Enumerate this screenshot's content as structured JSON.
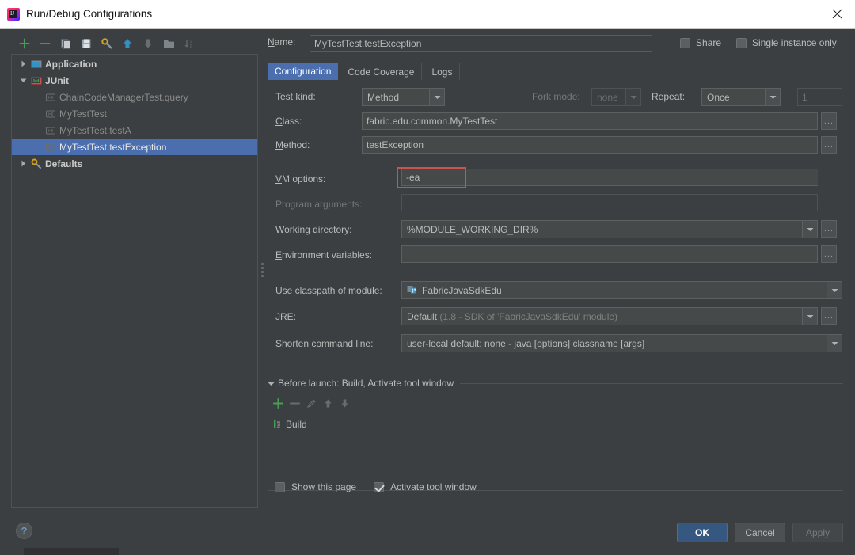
{
  "window": {
    "title": "Run/Debug Configurations",
    "app_icon": "intellij-idea-icon",
    "close_icon": "close-icon"
  },
  "toolbar": {
    "buttons": [
      {
        "name": "add-configuration-button",
        "icon": "plus-icon",
        "enabled": true
      },
      {
        "name": "remove-configuration-button",
        "icon": "minus-icon",
        "enabled": true
      },
      {
        "name": "copy-configuration-button",
        "icon": "copy-icon",
        "enabled": true
      },
      {
        "name": "save-configuration-button",
        "icon": "save-icon",
        "enabled": true
      },
      {
        "name": "edit-defaults-button",
        "icon": "wrench-icon",
        "enabled": true
      },
      {
        "name": "move-up-button",
        "icon": "arrow-up-icon",
        "enabled": true
      },
      {
        "name": "move-down-button",
        "icon": "arrow-down-icon",
        "enabled": false
      },
      {
        "name": "create-folder-button",
        "icon": "folder-icon",
        "enabled": false
      },
      {
        "name": "sort-configurations-button",
        "icon": "sort-icon",
        "enabled": false
      }
    ]
  },
  "tree": {
    "items": [
      {
        "label": "Application",
        "level": 0,
        "expanded": false,
        "bold": true,
        "icon": "application-icon",
        "selected": false,
        "dim": false
      },
      {
        "label": "JUnit",
        "level": 0,
        "expanded": true,
        "bold": true,
        "icon": "junit-icon",
        "selected": false,
        "dim": false
      },
      {
        "label": "ChainCodeManagerTest.query",
        "level": 1,
        "expanded": null,
        "bold": false,
        "icon": "junit-test-icon",
        "selected": false,
        "dim": true
      },
      {
        "label": "MyTestTest",
        "level": 1,
        "expanded": null,
        "bold": false,
        "icon": "junit-test-icon",
        "selected": false,
        "dim": true
      },
      {
        "label": "MyTestTest.testA",
        "level": 1,
        "expanded": null,
        "bold": false,
        "icon": "junit-test-icon",
        "selected": false,
        "dim": true
      },
      {
        "label": "MyTestTest.testException",
        "level": 1,
        "expanded": null,
        "bold": false,
        "icon": "junit-test-icon",
        "selected": true,
        "dim": false
      },
      {
        "label": "Defaults",
        "level": 0,
        "expanded": false,
        "bold": true,
        "icon": "defaults-icon",
        "selected": false,
        "dim": false
      }
    ]
  },
  "form": {
    "name_label": "Name:",
    "name_value": "MyTestTest.testException",
    "share_label": "Share",
    "share_checked": false,
    "single_instance_label": "Single instance only",
    "single_instance_checked": false,
    "tabs": [
      {
        "label": "Configuration",
        "active": true
      },
      {
        "label": "Code Coverage",
        "active": false
      },
      {
        "label": "Logs",
        "active": false
      }
    ],
    "test_kind_label": "Test kind:",
    "test_kind_value": "Method",
    "fork_mode_label": "Fork mode:",
    "fork_mode_value": "none",
    "fork_mode_enabled": false,
    "repeat_label": "Repeat:",
    "repeat_value": "Once",
    "repeat_count_value": "1",
    "repeat_count_enabled": false,
    "class_label": "Class:",
    "class_value": "fabric.edu.common.MyTestTest",
    "method_label": "Method:",
    "method_value": "testException",
    "vm_options_label": "VM options:",
    "vm_options_value": "-ea",
    "vm_options_highlighted": true,
    "program_arguments_label": "Program arguments:",
    "program_arguments_value": "",
    "working_directory_label": "Working directory:",
    "working_directory_value": "%MODULE_WORKING_DIR%",
    "environment_variables_label": "Environment variables:",
    "environment_variables_value": "",
    "use_classpath_label": "Use classpath of module:",
    "use_classpath_value": "FabricJavaSdkEdu",
    "use_classpath_icon": "module-icon",
    "jre_label": "JRE:",
    "jre_value_main": "Default",
    "jre_value_hint": "(1.8 - SDK of 'FabricJavaSdkEdu' module)",
    "shorten_command_line_label": "Shorten command line:",
    "shorten_command_line_value": "user-local default: none - java [options] classname [args]",
    "browse_label": "...",
    "expand_icon": "expand-arrows-icon",
    "dropdown_icon": "chevron-down-icon"
  },
  "before_launch": {
    "title": "Before launch: Build, Activate tool window",
    "toolbar": [
      {
        "name": "add-task-button",
        "icon": "plus-icon",
        "enabled": true
      },
      {
        "name": "remove-task-button",
        "icon": "minus-icon",
        "enabled": false
      },
      {
        "name": "edit-task-button",
        "icon": "pencil-icon",
        "enabled": false
      },
      {
        "name": "move-task-up-button",
        "icon": "arrow-up-icon",
        "enabled": false
      },
      {
        "name": "move-task-down-button",
        "icon": "arrow-down-icon",
        "enabled": false
      }
    ],
    "tasks": [
      {
        "label": "Build",
        "icon": "build-icon"
      }
    ],
    "show_this_page_label": "Show this page",
    "show_this_page_checked": false,
    "activate_tool_window_label": "Activate tool window",
    "activate_tool_window_checked": true
  },
  "footer": {
    "help_label": "?",
    "ok_label": "OK",
    "cancel_label": "Cancel",
    "apply_label": "Apply",
    "apply_enabled": false
  },
  "colors": {
    "background": "#3c3f41",
    "selection": "#4b6eaf",
    "accent_primary": "#365880",
    "error_border": "#c75450",
    "field_background": "#45494a",
    "text": "#bbbbbb",
    "text_dim": "#787878"
  }
}
